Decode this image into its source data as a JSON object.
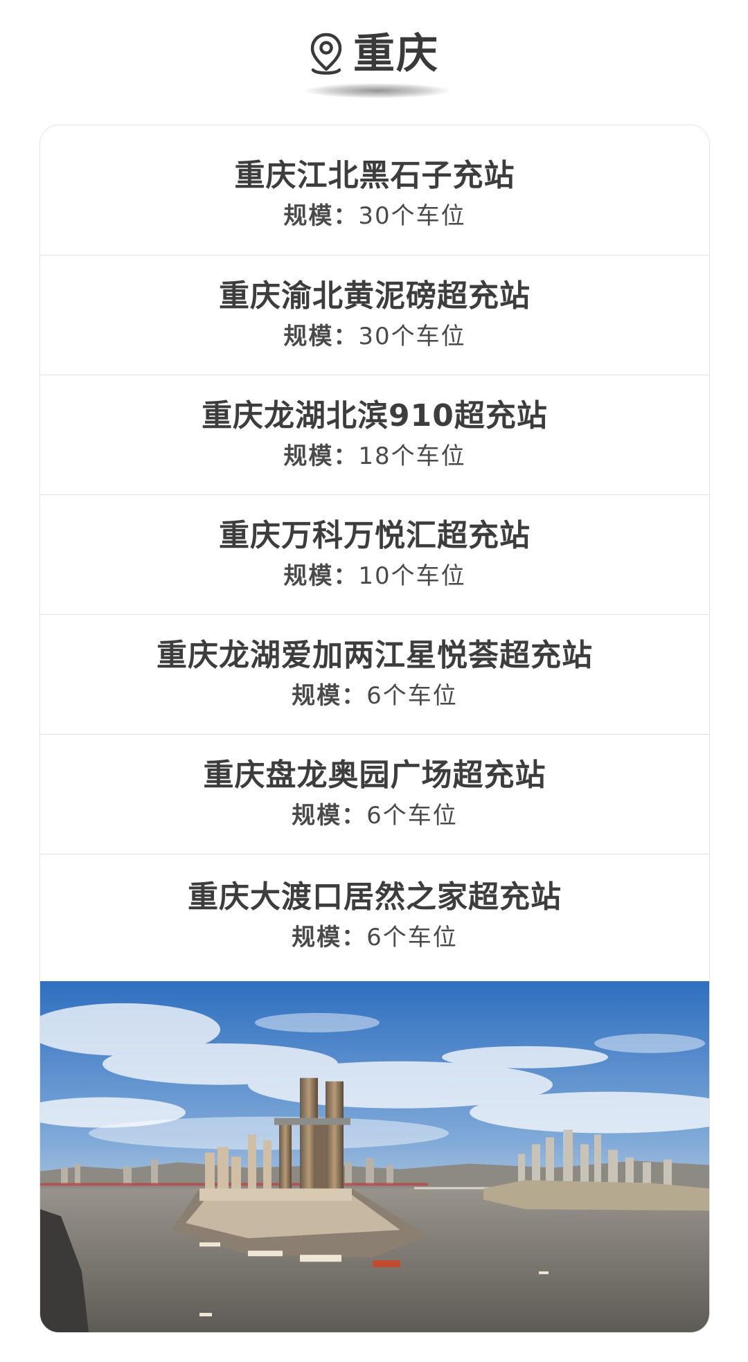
{
  "header": {
    "city": "重庆",
    "icon": "location-pin-icon"
  },
  "stations": [
    {
      "name": "重庆江北黑石子充站",
      "scale_label": "规模：",
      "scale_value": "30个车位"
    },
    {
      "name": "重庆渝北黄泥磅超充站",
      "scale_label": "规模：",
      "scale_value": "30个车位"
    },
    {
      "name": "重庆龙湖北滨910超充站",
      "scale_label": "规模：",
      "scale_value": "18个车位"
    },
    {
      "name": "重庆万科万悦汇超充站",
      "scale_label": "规模：",
      "scale_value": "10个车位"
    },
    {
      "name": "重庆龙湖爱加两江星悦荟超充站",
      "scale_label": "规模：",
      "scale_value": "6个车位"
    },
    {
      "name": "重庆盘龙奥园广场超充站",
      "scale_label": "规模：",
      "scale_value": "6个车位"
    },
    {
      "name": "重庆大渡口居然之家超充站",
      "scale_label": "规模：",
      "scale_value": "6个车位"
    }
  ],
  "colors": {
    "text_dark": "#3d3d3d",
    "divider": "#e2e2e2",
    "sky_top": "#2f6fc0",
    "river": "#6f6a63"
  }
}
